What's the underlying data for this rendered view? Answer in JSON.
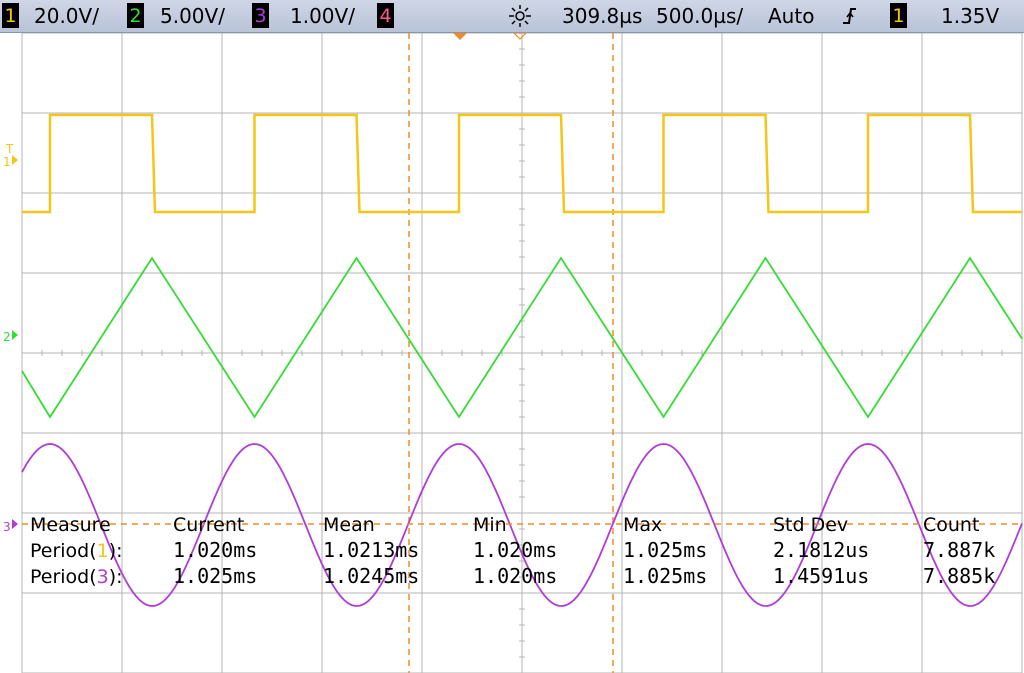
{
  "topbar": {
    "ch1": {
      "num": "1",
      "scale": "20.0V/",
      "color": "#f5c518"
    },
    "ch2": {
      "num": "2",
      "scale": "5.00V/",
      "color": "#33dd33"
    },
    "ch3": {
      "num": "3",
      "scale": "1.00V/",
      "color": "#b03cd8"
    },
    "ch4": {
      "num": "4",
      "color": "#ff5a8c"
    },
    "trigger_icon": "crosshair-trigger-icon",
    "time_delay": "309.8µs",
    "timebase": "500.0µs/",
    "trigger_mode": "Auto",
    "trigger_slope_icon": "rising-edge-icon",
    "trigger_source": "1",
    "trigger_level": "1.35V"
  },
  "markers": {
    "ch1": "1",
    "ch1_trigger": "T",
    "ch2": "2",
    "ch3": "3"
  },
  "measurements": {
    "headers": [
      "Measure",
      "Current",
      "Mean",
      "Min",
      "Max",
      "Std Dev",
      "Count"
    ],
    "rows": [
      {
        "label": "Period(",
        "channel": "1",
        "close": "):",
        "current": "1.020ms",
        "mean": "1.0213ms",
        "min": "1.020ms",
        "max": "1.025ms",
        "std_dev": "2.1812us",
        "count": "7.887k"
      },
      {
        "label": "Period(",
        "channel": "3",
        "close": "):",
        "current": "1.025ms",
        "mean": "1.0245ms",
        "min": "1.020ms",
        "max": "1.025ms",
        "std_dev": "1.4591us",
        "count": "7.885k"
      }
    ]
  },
  "colors": {
    "ch1": "#f5c518",
    "ch2": "#33dd33",
    "ch3": "#b03cd8",
    "ch4": "#ff5a8c",
    "cursor": "#f08c28",
    "grid": "#b4b4b4"
  }
}
